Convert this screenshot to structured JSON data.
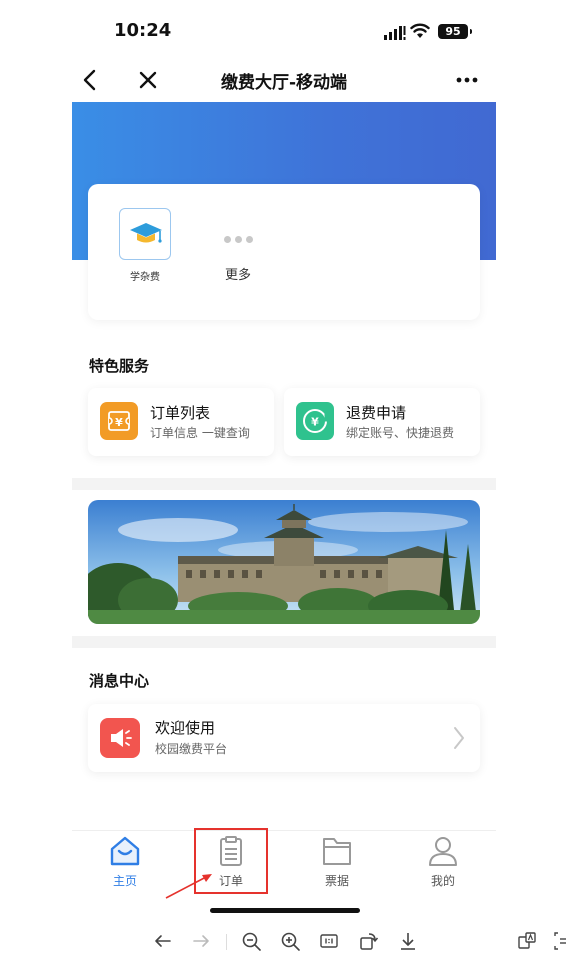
{
  "status": {
    "time": "10:24",
    "battery": "95"
  },
  "nav": {
    "title": "缴费大厅-移动端"
  },
  "apps": [
    {
      "label": "学杂费",
      "icon": "graduation-cap-icon"
    },
    {
      "label": "更多",
      "icon": "more-dots-icon"
    }
  ],
  "featured": {
    "title": "特色服务",
    "items": [
      {
        "title": "订单列表",
        "subtitle": "订单信息 一键查询",
        "icon": "ticket-yen-icon",
        "color": "#f29b26"
      },
      {
        "title": "退费申请",
        "subtitle": "绑定账号、快捷退费",
        "icon": "refund-yen-icon",
        "color": "#2fc28e"
      }
    ]
  },
  "messages": {
    "title": "消息中心",
    "items": [
      {
        "title": "欢迎使用",
        "subtitle": "校园缴费平台",
        "icon": "megaphone-icon",
        "color": "#f2554f"
      }
    ]
  },
  "tabbar": {
    "tabs": [
      {
        "label": "主页",
        "icon": "home-icon",
        "active": true
      },
      {
        "label": "订单",
        "icon": "clipboard-icon",
        "active": false
      },
      {
        "label": "票据",
        "icon": "folder-icon",
        "active": false
      },
      {
        "label": "我的",
        "icon": "person-icon",
        "active": false
      }
    ]
  },
  "colors": {
    "accent": "#2f7ee5",
    "banner": "#3a8ee6",
    "highlight": "#e5322d"
  }
}
